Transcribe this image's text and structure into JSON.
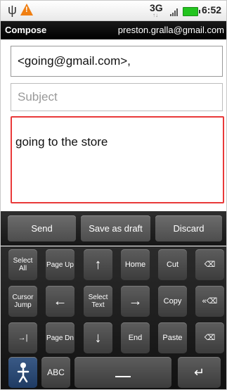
{
  "status_bar": {
    "usb_icon": "usb-icon",
    "warning_icon": "warning-icon",
    "network": "3G",
    "time": "6:52"
  },
  "compose": {
    "title": "Compose",
    "account": "preston.gralla@gmail.com",
    "to_value": "<going@gmail.com>,",
    "subject_placeholder": "Subject",
    "body_text": "going to the store"
  },
  "actions": {
    "send": "Send",
    "save_draft": "Save as draft",
    "discard": "Discard"
  },
  "keyboard": {
    "row1": [
      "Select All",
      "Page Up",
      "↑",
      "Home",
      "Cut",
      "⌫"
    ],
    "row2": [
      "Cursor Jump",
      "←",
      "Select Text",
      "→",
      "Copy",
      "«⌫"
    ],
    "row3": [
      "→|",
      "Page Dn",
      "↓",
      "End",
      "Paste",
      "⌫"
    ],
    "row4": [
      "ABC",
      "↵"
    ]
  },
  "colors": {
    "focus_border": "#e93939",
    "battery": "#23c41f",
    "warning": "#f07f12"
  }
}
